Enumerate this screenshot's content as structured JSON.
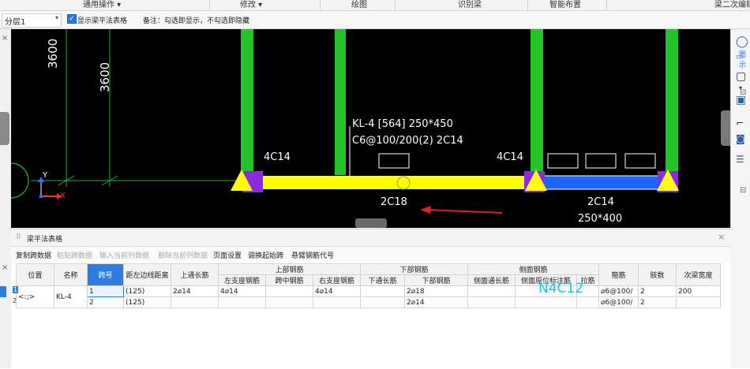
{
  "ribbon": {
    "groups": [
      "通用操作 ▾",
      "修改 ▾",
      "绘图",
      "识别梁",
      "智能布置",
      "梁二次编辑"
    ]
  },
  "toolbar": {
    "floor_value": "分层1",
    "show_table_label": "显示梁平法表格",
    "note": "备注：勾选即显示，不勾选即隐藏"
  },
  "canvas": {
    "dim_labels": [
      "3600",
      "3600"
    ],
    "beam_title": "KL-4 [564] 250*450",
    "stirrup_spec": "C6@100/200(2) 2C14",
    "left_top_rebar": "4C14",
    "right_top_rebar": "4C14",
    "bottom_rebar_span1": "2C18",
    "bottom_rebar_span2": "2C14",
    "span2_section": "250*400",
    "axis_x": "X",
    "axis_y": "Y",
    "colors": {
      "beam_span1": "#ffff00",
      "beam_span2": "#1e64ff",
      "column": "#22c42a",
      "support": "#8a2be2",
      "arrow": "#e02020",
      "background": "#000000"
    }
  },
  "panel": {
    "title": "梁平法表格",
    "tools": [
      "复制跨数据",
      "粘贴跨数据",
      "输入当前列数据",
      "删除当前列数据",
      "页面设置",
      "调换起始跨",
      "悬臂钢筋代号"
    ],
    "tools_disabled": [
      false,
      true,
      true,
      true,
      false,
      false,
      false
    ]
  },
  "table": {
    "group_headers": {
      "top_rebar": "上部钢筋",
      "bottom_rebar": "下部钢筋",
      "side_rebar": "侧面钢筋"
    },
    "headers": {
      "position": "位置",
      "name": "名称",
      "span_no": "跨号",
      "dist_left": "距左边线距离",
      "top_through": "上通长筋",
      "left_support": "左支座钢筋",
      "mid_span": "跨中钢筋",
      "right_support": "右支座钢筋",
      "bottom_through": "下通长筋",
      "bottom_rebar": "下部钢筋",
      "side_through": "侧面通长筋",
      "side_original": "侧面原位标注筋",
      "tie": "拉筋",
      "stirrup": "箍筋",
      "legs": "肢数",
      "sec_beam_width": "次梁宽度"
    },
    "rows": [
      {
        "position": "<:;>",
        "name": "KL-4",
        "span_no": "1",
        "dist_left": "(125)",
        "top_through": "2⌀14",
        "left_support": "4⌀14",
        "mid_span": "",
        "right_support": "4⌀14",
        "bottom_through": "",
        "bottom_rebar": "2⌀18",
        "side_through": "",
        "side_original": "",
        "tie": "",
        "stirrup": "⌀6@100/",
        "legs": "2",
        "sec_beam_width": "200"
      },
      {
        "position": "",
        "name": "",
        "span_no": "2",
        "dist_left": "(125)",
        "top_through": "",
        "left_support": "",
        "mid_span": "",
        "right_support": "",
        "bottom_through": "",
        "bottom_rebar": "2⌀14",
        "side_through": "",
        "side_original": "",
        "tie": "",
        "stirrup": "⌀6@100/",
        "legs": "2",
        "sec_beam_width": ""
      }
    ],
    "overlay_label": "N4C12",
    "row_markers": [
      "1",
      "2"
    ]
  },
  "right_panel": {
    "tab": "图示"
  }
}
